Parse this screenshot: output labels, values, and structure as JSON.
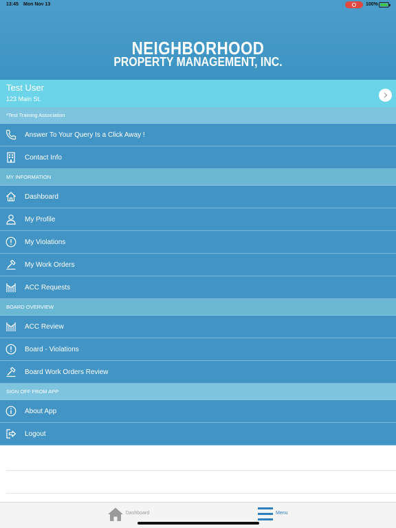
{
  "status": {
    "time": "13:45",
    "date": "Mon Nov 13",
    "battery": "100%"
  },
  "header": {
    "logo_line1": "NEIGHBORHOOD",
    "logo_line2": "PROPERTY MANAGEMENT, INC."
  },
  "user": {
    "name": "Test User",
    "address": "123 Main St."
  },
  "sections": {
    "association": "*Test Training Association",
    "my_information": "MY INFORMATION",
    "board_overview": "BOARD OVERVIEW",
    "sign_off": "SIGN OFF FROM APP"
  },
  "items": {
    "query": "Answer To Your Query Is a Click Away !",
    "contact": "Contact Info",
    "dashboard": "Dashboard",
    "profile": "My Profile",
    "violations": "My Violations",
    "work_orders": "My Work Orders",
    "acc_requests": "ACC Requests",
    "acc_review": "ACC Review",
    "board_violations": "Board - Violations",
    "board_work_orders": "Board Work Orders Review",
    "about": "About App",
    "logout": "Logout"
  },
  "tabbar": {
    "dashboard": "Dashboard",
    "menu": "Menu"
  },
  "colors": {
    "header": "#4a9dca",
    "menu_item": "#4194c3",
    "section": "#6ab7d4",
    "user_card": "#6cd4e8",
    "tab_active": "#2f7fbe"
  },
  "icons": {
    "query": "phone-icon",
    "contact": "building-icon",
    "dashboard": "home-icon",
    "profile": "person-icon",
    "violations": "exclamation-circle-icon",
    "work_orders": "hammer-icon",
    "acc": "gate-icon",
    "about": "info-circle-icon",
    "logout": "logout-icon"
  }
}
